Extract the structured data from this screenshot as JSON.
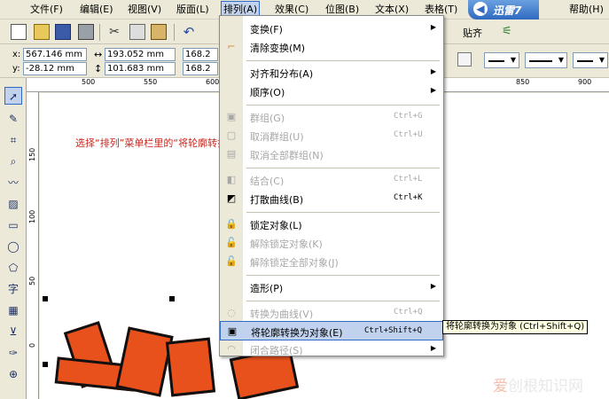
{
  "menubar": {
    "items": [
      "文件(F)",
      "编辑(E)",
      "视图(V)",
      "版面(L)",
      "排列(A)",
      "效果(C)",
      "位图(B)",
      "文本(X)",
      "表格(T)",
      "帮助(H)"
    ],
    "logo_text": "迅雷7"
  },
  "toolbar": {
    "snap_label": "贴齐",
    "x_label": "x:",
    "y_label": "y:",
    "x_value": "567.146 mm",
    "y_value": "-28.12 mm",
    "width_value": "193.052 mm",
    "height_value": "101.683 mm",
    "scale_w": "168.2",
    "scale_h": "168.2"
  },
  "ruler": {
    "top": [
      "500",
      "550",
      "600",
      "850",
      "900"
    ],
    "left": [
      "150",
      "100",
      "50",
      "0"
    ]
  },
  "canvas": {
    "instruction": "选择“排列”菜单栏里的“将轮廓转换为对象”"
  },
  "menu": {
    "items": [
      {
        "label": "变换(F)",
        "shortcut": "",
        "submenu": true,
        "disabled": false
      },
      {
        "label": "清除变换(M)",
        "shortcut": "",
        "submenu": false,
        "disabled": false
      },
      {
        "label": "对齐和分布(A)",
        "shortcut": "",
        "submenu": true,
        "disabled": false
      },
      {
        "label": "顺序(O)",
        "shortcut": "",
        "submenu": true,
        "disabled": false
      },
      {
        "label": "群组(G)",
        "shortcut": "Ctrl+G",
        "submenu": false,
        "disabled": true
      },
      {
        "label": "取消群组(U)",
        "shortcut": "Ctrl+U",
        "submenu": false,
        "disabled": true
      },
      {
        "label": "取消全部群组(N)",
        "shortcut": "",
        "submenu": false,
        "disabled": true
      },
      {
        "label": "结合(C)",
        "shortcut": "Ctrl+L",
        "submenu": false,
        "disabled": true
      },
      {
        "label": "打散曲线(B)",
        "shortcut": "Ctrl+K",
        "submenu": false,
        "disabled": false
      },
      {
        "label": "锁定对象(L)",
        "shortcut": "",
        "submenu": false,
        "disabled": false
      },
      {
        "label": "解除锁定对象(K)",
        "shortcut": "",
        "submenu": false,
        "disabled": true
      },
      {
        "label": "解除锁定全部对象(J)",
        "shortcut": "",
        "submenu": false,
        "disabled": true
      },
      {
        "label": "造形(P)",
        "shortcut": "",
        "submenu": true,
        "disabled": false
      },
      {
        "label": "转换为曲线(V)",
        "shortcut": "Ctrl+Q",
        "submenu": false,
        "disabled": true
      },
      {
        "label": "将轮廓转换为对象(E)",
        "shortcut": "Ctrl+Shift+Q",
        "submenu": false,
        "disabled": false
      },
      {
        "label": "闭合路径(S)",
        "shortcut": "",
        "submenu": true,
        "disabled": true
      }
    ]
  },
  "tooltip": "将轮廓转换为对象 (Ctrl+Shift+Q)",
  "watermark": {
    "brand": "爱",
    "rest": "创根知识网"
  }
}
